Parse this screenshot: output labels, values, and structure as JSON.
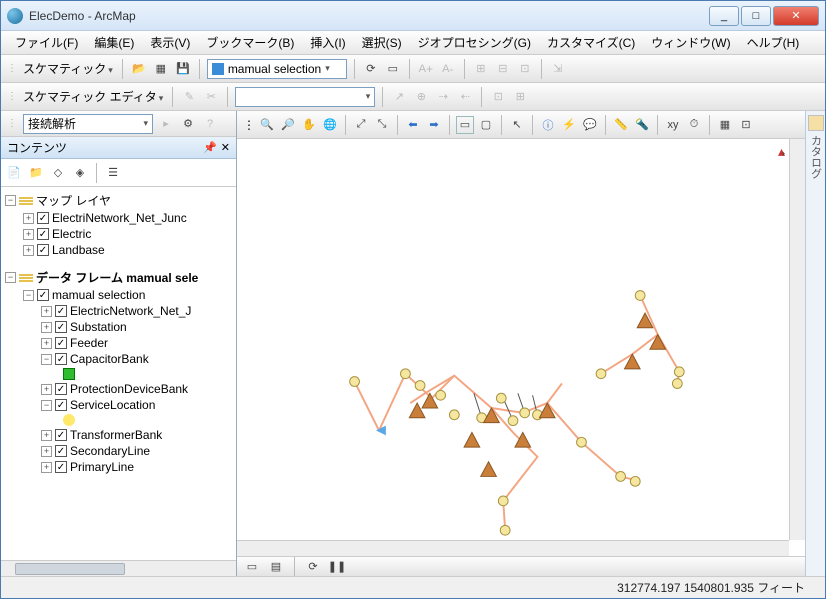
{
  "window": {
    "title": "ElecDemo - ArcMap"
  },
  "menus": [
    "ファイル(F)",
    "編集(E)",
    "表示(V)",
    "ブックマーク(B)",
    "挿入(I)",
    "選択(S)",
    "ジオプロセシング(G)",
    "カスタマイズ(C)",
    "ウィンドウ(W)",
    "ヘルプ(H)"
  ],
  "toolbar_schematic": {
    "label": "スケマティック",
    "combo_value": "mamual selection"
  },
  "toolbar_editor": {
    "label": "スケマティック エディタ",
    "combo_value": ""
  },
  "toolbar_analysis": {
    "combo_value": "接続解析"
  },
  "toc": {
    "title": "コンテンツ",
    "frame1": {
      "label": "マップ レイヤ",
      "layers": [
        "ElectriNetwork_Net_Junc",
        "Electric",
        "Landbase"
      ]
    },
    "frame2": {
      "label": "データ フレーム mamual sele",
      "group": {
        "label": "mamual selection",
        "layers": [
          "ElectricNetwork_Net_J",
          "Substation",
          "Feeder",
          "CapacitorBank",
          "ProtectionDeviceBank",
          "ServiceLocation",
          "TransformerBank",
          "SecondaryLine",
          "PrimaryLine"
        ]
      }
    }
  },
  "status": {
    "coords": "312774.197  1540801.935 フィート"
  },
  "right_rail": {
    "label": "カタログ"
  }
}
